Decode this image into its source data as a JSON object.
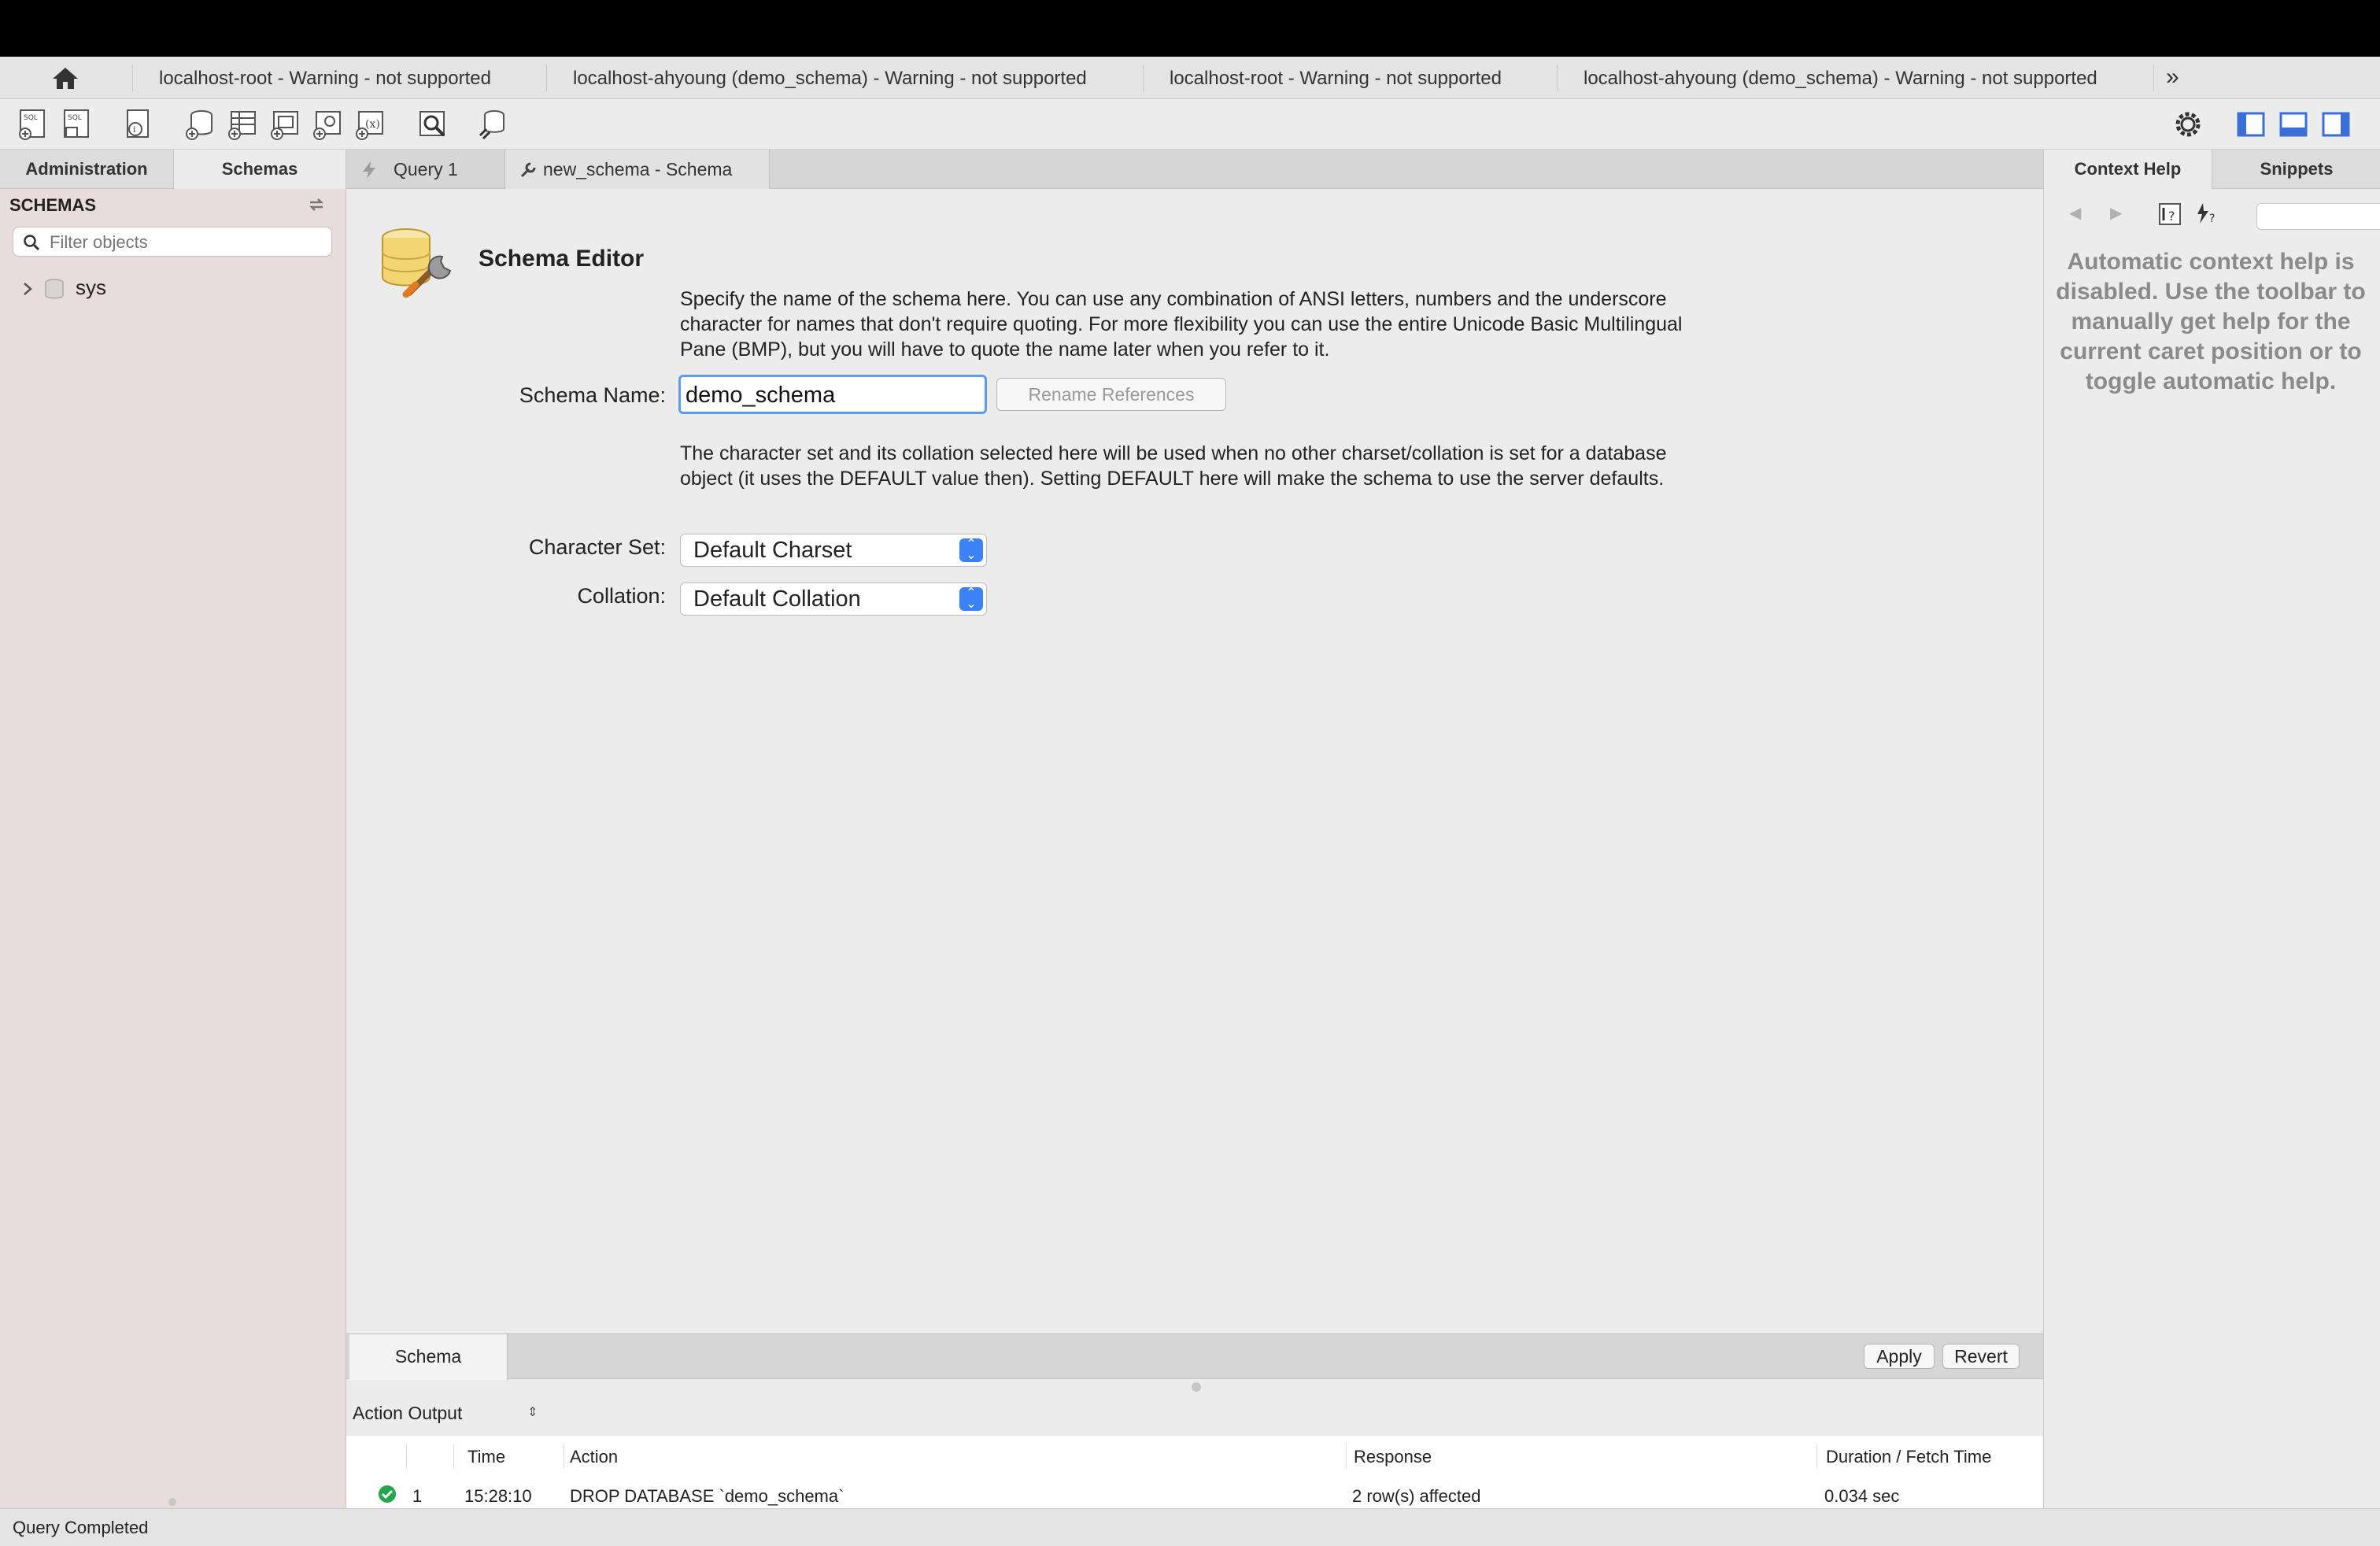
{
  "connection_tabs": [
    {
      "label": "localhost-root - Warning - not supported"
    },
    {
      "label": "localhost-ahyoung (demo_schema) - Warning - not supported"
    },
    {
      "label": "localhost-root - Warning - not supported"
    },
    {
      "label": "localhost-ahyoung (demo_schema) - Warning - not supported"
    }
  ],
  "left_tabs": {
    "administration": "Administration",
    "schemas": "Schemas"
  },
  "sidebar": {
    "header": "SCHEMAS",
    "filter_placeholder": "Filter objects",
    "tree": [
      {
        "label": "sys"
      }
    ]
  },
  "editor_tabs": {
    "query": "Query 1",
    "schema": "new_schema - Schema"
  },
  "schema_editor": {
    "title": "Schema Editor",
    "intro": "Specify the name of the schema here. You can use any combination of ANSI letters, numbers and the underscore character for names that don't require quoting. For more flexibility you can use the entire Unicode Basic Multilingual Pane (BMP), but you will have to quote the name later when you refer to it.",
    "schema_name_label": "Schema Name:",
    "schema_name_value": "demo_schema",
    "rename_button": "Rename References",
    "charset_intro": "The character set and its collation selected here will be used when no other charset/collation is set for a database object (it uses the DEFAULT value then). Setting DEFAULT here will make the schema to use the server defaults.",
    "charset_label": "Character Set:",
    "charset_value": "Default Charset",
    "collation_label": "Collation:",
    "collation_value": "Default Collation"
  },
  "bottom_tabs": {
    "schema": "Schema",
    "apply": "Apply",
    "revert": "Revert"
  },
  "output": {
    "selector": "Action Output",
    "columns": [
      "Time",
      "Action",
      "Response",
      "Duration / Fetch Time"
    ],
    "rows": [
      {
        "index": "1",
        "time": "15:28:10",
        "action": "DROP DATABASE `demo_schema`",
        "response": "2 row(s) affected",
        "duration": "0.034 sec"
      }
    ]
  },
  "right_tabs": {
    "context_help": "Context Help",
    "snippets": "Snippets"
  },
  "context_help_text": "Automatic context help is disabled. Use the toolbar to manually get help for the current caret position or to toggle automatic help.",
  "status": "Query Completed",
  "colors": {
    "accent": "#3b82f6",
    "sidebar_bg": "#e8dcdd",
    "success": "#22a84a"
  }
}
